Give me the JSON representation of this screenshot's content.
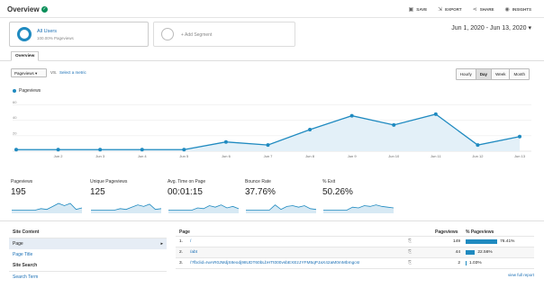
{
  "header": {
    "title": "Overview",
    "actions": [
      "SAVE",
      "EXPORT",
      "SHARE",
      "INSIGHTS"
    ]
  },
  "segments": {
    "all_users_name": "All Users",
    "all_users_sub": "100.00% Pageviews",
    "add_segment": "+ Add Segment"
  },
  "date_range": "Jun 1, 2020 - Jun 13, 2020",
  "tabs": [
    "Overview"
  ],
  "metric_selector": "Pageviews",
  "vs_label": "VS.",
  "select_metric": "Select a metric",
  "granularity": [
    "Hourly",
    "Day",
    "Week",
    "Month"
  ],
  "granularity_selected": "Day",
  "legend_label": "Pageviews",
  "chart_data": {
    "type": "area",
    "x": [
      "Jun 1",
      "Jun 2",
      "Jun 3",
      "Jun 4",
      "Jun 5",
      "Jun 6",
      "Jun 7",
      "Jun 8",
      "Jun 9",
      "Jun 10",
      "Jun 11",
      "Jun 12",
      "Jun 13"
    ],
    "x_labels": [
      "",
      "Jun 2",
      "Jun 3",
      "Jun 4",
      "Jun 5",
      "Jun 6",
      "Jun 7",
      "Jun 8",
      "Jun 9",
      "Jun 10",
      "Jun 11",
      "Jun 12",
      "Jun 13"
    ],
    "series": [
      {
        "name": "Pageviews",
        "values": [
          2,
          2,
          2,
          2,
          2,
          12,
          8,
          28,
          46,
          34,
          48,
          8,
          19
        ]
      }
    ],
    "y_ticks": [
      20,
      40,
      60
    ],
    "ylim": [
      0,
      70
    ],
    "grid": true,
    "color": "#1f8ac0"
  },
  "summary": [
    {
      "label": "Pageviews",
      "value": "195",
      "spark": [
        3,
        3,
        3,
        3,
        3,
        5,
        4,
        8,
        12,
        9,
        12,
        4,
        6
      ]
    },
    {
      "label": "Unique Pageviews",
      "value": "125",
      "spark": [
        3,
        3,
        3,
        3,
        3,
        5,
        4,
        7,
        10,
        8,
        11,
        4,
        5
      ]
    },
    {
      "label": "Avg. Time on Page",
      "value": "00:01:15",
      "spark": [
        3,
        3,
        3,
        3,
        3,
        6,
        5,
        9,
        7,
        10,
        6,
        8,
        5
      ]
    },
    {
      "label": "Bounce Rate",
      "value": "37.76%",
      "spark": [
        3,
        3,
        3,
        3,
        3,
        10,
        4,
        8,
        9,
        7,
        9,
        5,
        4
      ]
    },
    {
      "label": "% Exit",
      "value": "50.26%",
      "spark": [
        3,
        3,
        3,
        3,
        3,
        7,
        6,
        9,
        8,
        10,
        8,
        7,
        6
      ]
    }
  ],
  "left_panel": {
    "site_content": "Site Content",
    "page": "Page",
    "page_title": "Page Title",
    "site_search": "Site Search",
    "search_term": "Search Term"
  },
  "table": {
    "col_page": "Page",
    "col_pageviews": "Pageviews",
    "col_pct": "% Pageviews",
    "rows": [
      {
        "num": "1.",
        "page": "/",
        "views": "149",
        "pct": "76.41%",
        "frac": 0.7641
      },
      {
        "num": "2.",
        "page": "/abt",
        "views": "44",
        "pct": "22.56%",
        "frac": 0.2256
      },
      {
        "num": "3.",
        "page": "/?fbclid=IwAR0JMdjS8eodj98UDT60bLbHTt000vsbEXEzJYFM5qPJaX42aM0mMbmgcsI",
        "views": "2",
        "pct": "1.03%",
        "frac": 0.0103
      }
    ],
    "view_full": "view full report"
  }
}
